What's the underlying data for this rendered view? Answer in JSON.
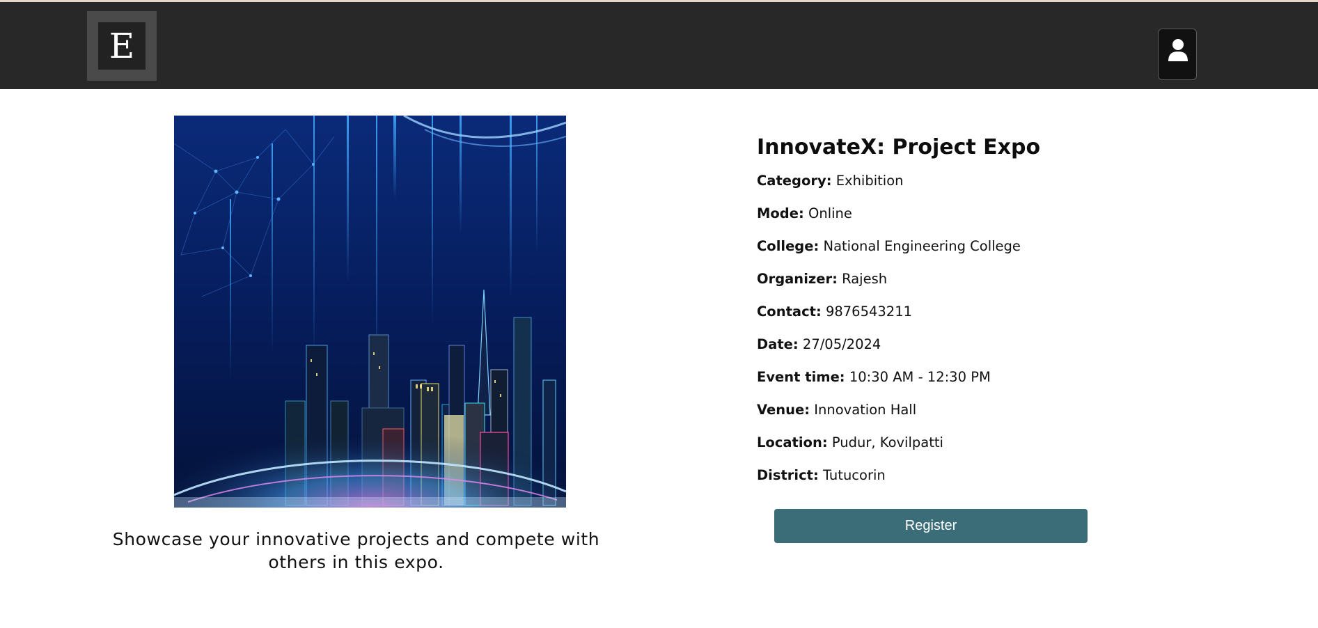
{
  "header": {
    "logo_letter": "E",
    "profile_icon": "user-icon"
  },
  "event": {
    "title": "InnovateX: Project Expo",
    "description": "Showcase your innovative projects and compete with others in this expo.",
    "details": [
      {
        "label": "Category:",
        "value": "Exhibition"
      },
      {
        "label": "Mode:",
        "value": "Online"
      },
      {
        "label": "College:",
        "value": "National Engineering College"
      },
      {
        "label": "Organizer:",
        "value": "Rajesh"
      },
      {
        "label": "Contact:",
        "value": "9876543211"
      },
      {
        "label": "Date:",
        "value": "27/05/2024"
      },
      {
        "label": "Event time:",
        "value": "10:30 AM - 12:30 PM"
      },
      {
        "label": "Venue:",
        "value": "Innovation Hall"
      },
      {
        "label": "Location:",
        "value": "Pudur, Kovilpatti"
      },
      {
        "label": "District:",
        "value": "Tutucorin"
      }
    ],
    "register_label": "Register"
  },
  "colors": {
    "navbar": "#282828",
    "accent_button": "#3b6d78",
    "poster_background": "#05184a"
  }
}
